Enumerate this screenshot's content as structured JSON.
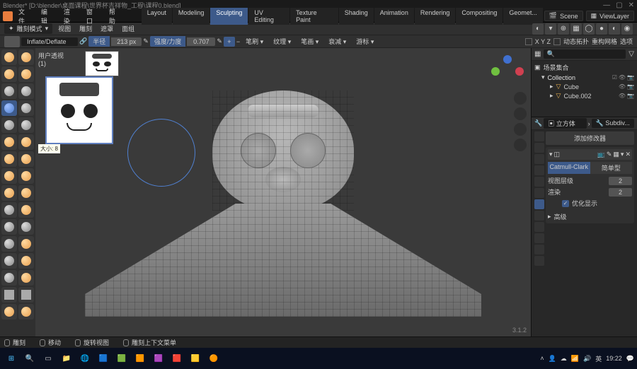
{
  "titlebar": {
    "title": "Blender* [D:\\blender\\桌面课程\\世界杯吉祥物_工程\\课程0.blend]"
  },
  "menubar": {
    "items": [
      "文件",
      "编辑",
      "渲染",
      "窗口",
      "帮助"
    ],
    "workspaces": [
      "Layout",
      "Modeling",
      "Sculpting",
      "UV Editing",
      "Texture Paint",
      "Shading",
      "Animation",
      "Rendering",
      "Compositing",
      "Geomet..."
    ],
    "active_workspace": "Sculpting",
    "scene_label": "Scene",
    "viewlayer_label": "ViewLayer"
  },
  "toolheader": {
    "mode": "雕刻模式",
    "menus": [
      "视图",
      "雕刻",
      "遮罩",
      "面组"
    ]
  },
  "brushbar": {
    "brush_name": "Inflate/Deflate",
    "radius_label": "半径",
    "radius_value": "213 px",
    "strength_label": "强度/力度",
    "strength_value": "0.707",
    "dropdowns": [
      "笔刷",
      "纹理",
      "笔画",
      "衰减",
      "游标"
    ],
    "xyz_label": "X Y Z",
    "dyntopo_label": "动态拓扑",
    "remesh_label": "重构网格",
    "options_label": "选项"
  },
  "viewport": {
    "user_label": "用户透视",
    "counter": "(1)",
    "tooltip": "大小: 8",
    "version": "3.1.2"
  },
  "outliner": {
    "header": "场景集合",
    "collection": "Collection",
    "items": [
      "Cube",
      "Cube.002"
    ]
  },
  "properties": {
    "object_name": "立方体",
    "modifier_name": "Subdiv...",
    "add_modifier_label": "添加修改器",
    "subdiv_tabs": [
      "Catmull-Clark",
      "简单型"
    ],
    "viewport_levels_label": "视图层级",
    "viewport_levels_value": "2",
    "render_levels_label": "渲染",
    "render_levels_value": "2",
    "optimal_display_label": "优化显示",
    "advanced_label": "高级"
  },
  "footer": {
    "sculpt_label": "雕刻",
    "move_label": "移动",
    "rotate_label": "旋转视图",
    "context_label": "雕刻上下文菜单"
  },
  "taskbar": {
    "ime": "英",
    "time": "19:22"
  }
}
